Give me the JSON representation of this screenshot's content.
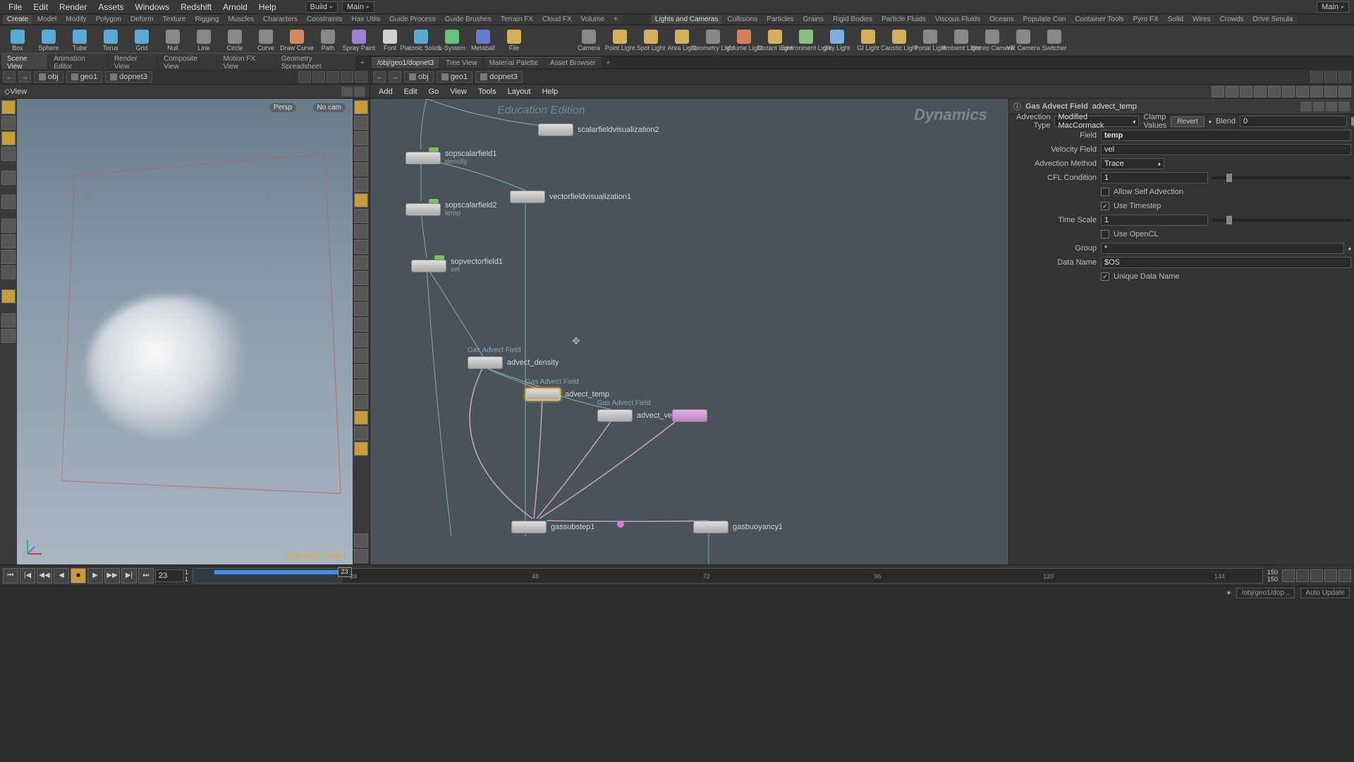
{
  "menubar": {
    "items": [
      "File",
      "Edit",
      "Render",
      "Assets",
      "Windows",
      "Redshift",
      "Arnold",
      "Help"
    ],
    "desktop": "Build",
    "context": "Main",
    "right_context": "Main"
  },
  "shelf_tabs_left": [
    "Create",
    "Model",
    "Modify",
    "Polygon",
    "Deform",
    "Texture",
    "Rigging",
    "Muscles",
    "Characters",
    "Constraints",
    "Hair Utils",
    "Guide Process",
    "Guide Brushes",
    "Terrain FX",
    "Cloud FX",
    "Volume"
  ],
  "shelf_tabs_right": [
    "Lights and Cameras",
    "Collisions",
    "Particles",
    "Grains",
    "Rigid Bodies",
    "Particle Fluids",
    "Viscous Fluids",
    "Oceans",
    "Populate Con",
    "Container Tools",
    "Pyro FX",
    "Solid",
    "Wires",
    "Crowds",
    "Drive Simula"
  ],
  "shelf_left": [
    {
      "label": "Box",
      "color": "#5aaad4"
    },
    {
      "label": "Sphere",
      "color": "#5aaad4"
    },
    {
      "label": "Tube",
      "color": "#5aaad4"
    },
    {
      "label": "Torus",
      "color": "#5aaad4"
    },
    {
      "label": "Grid",
      "color": "#5aaad4"
    },
    {
      "label": "Null",
      "color": "#888"
    },
    {
      "label": "Line",
      "color": "#888"
    },
    {
      "label": "Circle",
      "color": "#888"
    },
    {
      "label": "Curve",
      "color": "#888"
    },
    {
      "label": "Draw Curve",
      "color": "#d48a5a"
    },
    {
      "label": "Path",
      "color": "#888"
    },
    {
      "label": "Spray Paint",
      "color": "#a080d0"
    },
    {
      "label": "Font",
      "color": "#d0d0d0"
    },
    {
      "label": "Platonic Solids",
      "color": "#5aaad4"
    },
    {
      "label": "L-System",
      "color": "#6ac080"
    },
    {
      "label": "Metaball",
      "color": "#6a7ad0"
    },
    {
      "label": "File",
      "color": "#d4b05a"
    }
  ],
  "shelf_right": [
    {
      "label": "Camera",
      "color": "#888"
    },
    {
      "label": "Point Light",
      "color": "#d4b05a"
    },
    {
      "label": "Spot Light",
      "color": "#d4b05a"
    },
    {
      "label": "Area Light",
      "color": "#d4b05a"
    },
    {
      "label": "Geometry Light",
      "color": "#888"
    },
    {
      "label": "Volume Light",
      "color": "#d4805a"
    },
    {
      "label": "Distant Light",
      "color": "#d4b05a"
    },
    {
      "label": "Environment Light",
      "color": "#8ac080"
    },
    {
      "label": "Sky Light",
      "color": "#7ab0e0"
    },
    {
      "label": "GI Light",
      "color": "#d4b05a"
    },
    {
      "label": "Caustic Light",
      "color": "#d4b05a"
    },
    {
      "label": "Portal Light",
      "color": "#888"
    },
    {
      "label": "Ambient Light",
      "color": "#888"
    },
    {
      "label": "Stereo Camera",
      "color": "#888"
    },
    {
      "label": "VR Camera",
      "color": "#888"
    },
    {
      "label": "Switcher",
      "color": "#888"
    }
  ],
  "pane_tabs_left": [
    "Scene View",
    "Animation Editor",
    "Render View",
    "Composite View",
    "Motion FX View",
    "Geometry Spreadsheet"
  ],
  "pane_tabs_right": [
    "/obj/geo1/dopnet3",
    "Tree View",
    "Material Palette",
    "Asset Browser"
  ],
  "breadcrumbs": [
    "obj",
    "geo1",
    "dopnet3"
  ],
  "viewport": {
    "label": "View",
    "camera": "Persp",
    "cam_menu": "No cam",
    "footer": "Education Edition"
  },
  "network": {
    "menu": [
      "Add",
      "Edit",
      "Go",
      "View",
      "Tools",
      "Layout",
      "Help"
    ],
    "title": "Dynamics",
    "edu": "Education Edition",
    "nodes": {
      "scalarfieldvisualization2": "scalarfieldvisualization2",
      "sopscalarfield1": "sopscalarfield1",
      "sopscalarfield1_sub": "density",
      "sopscalarfield2": "sopscalarfield2",
      "sopscalarfield2_sub": "temp",
      "vectorfieldvisualization1": "vectorfieldvisualization1",
      "sopvectorfield1": "sopvectorfield1",
      "sopvectorfield1_sub": "vel",
      "advect_density_type": "Gas Advect Field",
      "advect_density": "advect_density",
      "advect_temp_type": "Gas Advect Field",
      "advect_temp": "advect_temp",
      "advect_vel_type": "Gas Advect Field",
      "advect_vel": "advect_vel",
      "gassubstep1": "gassubstep1",
      "gasbuoyancy1": "gasbuoyancy1"
    }
  },
  "params": {
    "node_type": "Gas Advect Field",
    "node_name": "advect_temp",
    "advection_type_lbl": "Advection Type",
    "advection_type_val": "Modified MacCormack",
    "clamp_lbl": "Clamp Values",
    "revert_btn": "Revert",
    "blend_lbl": "Blend",
    "blend_val": "0",
    "field_lbl": "Field",
    "field_val": "temp",
    "velfield_lbl": "Velocity Field",
    "velfield_val": "vel",
    "advmethod_lbl": "Advection Method",
    "advmethod_val": "Trace",
    "cfl_lbl": "CFL Condition",
    "cfl_val": "1",
    "selfadv_lbl": "Allow Self Advection",
    "timestep_lbl": "Use Timestep",
    "timescale_lbl": "Time Scale",
    "timescale_val": "1",
    "opencl_lbl": "Use OpenCL",
    "group_lbl": "Group",
    "group_val": "*",
    "dataname_lbl": "Data Name",
    "dataname_val": "$OS",
    "unique_lbl": "Unique Data Name"
  },
  "timeline": {
    "current": "23",
    "start": "1",
    "start2": "1",
    "end": "150",
    "end2": "150",
    "ticks": [
      "24",
      "48",
      "72",
      "96",
      "120",
      "144"
    ],
    "head": "23"
  },
  "status": {
    "path": "/obj/geo1/dop...",
    "mode": "Auto Update"
  }
}
